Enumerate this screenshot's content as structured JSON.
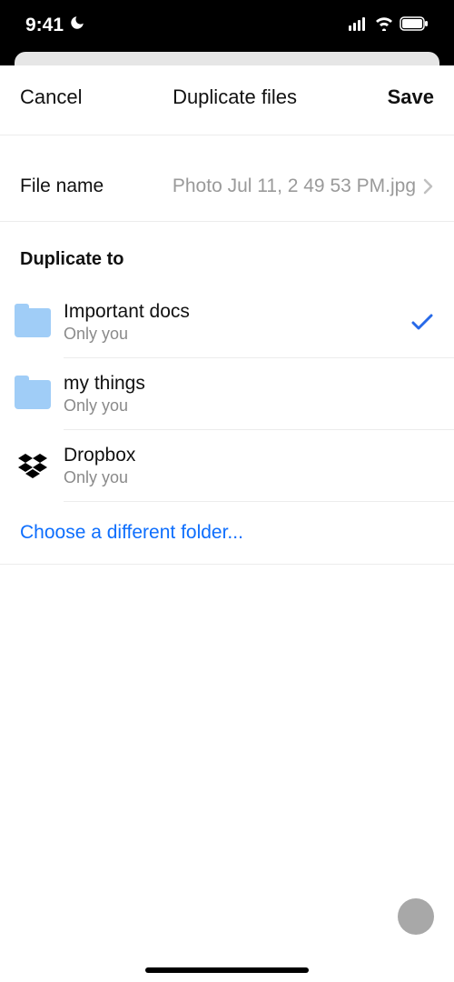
{
  "status": {
    "time": "9:41"
  },
  "nav": {
    "cancel": "Cancel",
    "title": "Duplicate files",
    "save": "Save"
  },
  "filename": {
    "label": "File name",
    "value": "Photo Jul 11, 2 49 53 PM.jpg"
  },
  "section": {
    "title": "Duplicate to"
  },
  "folders": [
    {
      "name": "Important docs",
      "sub": "Only you",
      "icon": "folder",
      "selected": true
    },
    {
      "name": "my things",
      "sub": "Only you",
      "icon": "folder",
      "selected": false
    },
    {
      "name": "Dropbox",
      "sub": "Only you",
      "icon": "dropbox",
      "selected": false
    }
  ],
  "chooseDifferent": "Choose a different folder..."
}
